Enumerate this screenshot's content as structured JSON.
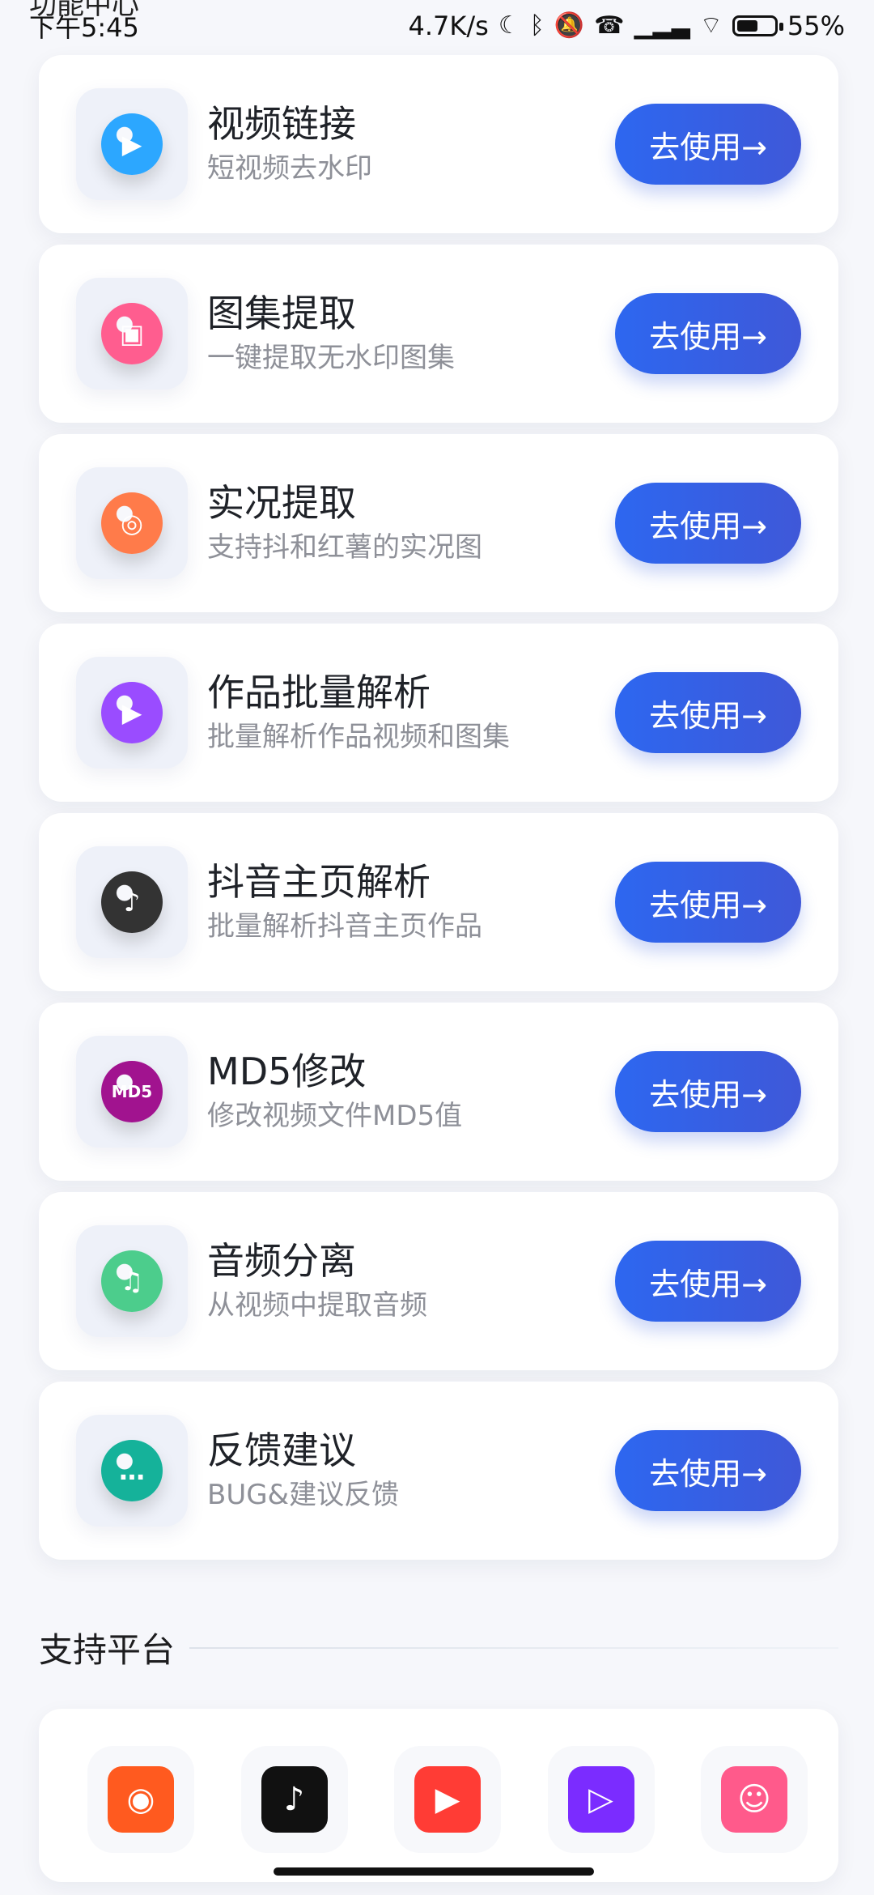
{
  "header": {
    "clipped_title": "功能中心"
  },
  "status_bar": {
    "time": "下午5:45",
    "network_speed": "4.7K/s",
    "battery": "55%"
  },
  "features": [
    {
      "title": "视频链接",
      "subtitle": "短视频去水印",
      "button_label": "去使用→",
      "icon_name": "play-circle-icon",
      "icon_symbol": "▶",
      "color": "#2ca7ff"
    },
    {
      "title": "图集提取",
      "subtitle": "一键提取无水印图集",
      "button_label": "去使用→",
      "icon_name": "image-icon",
      "icon_symbol": "▣",
      "color": "#ff5d8f"
    },
    {
      "title": "实况提取",
      "subtitle": "支持抖和红薯的实况图",
      "button_label": "去使用→",
      "icon_name": "live-photo-icon",
      "icon_symbol": "◎",
      "color": "#ff7b4a"
    },
    {
      "title": "作品批量解析",
      "subtitle": "批量解析作品视频和图集",
      "button_label": "去使用→",
      "icon_name": "film-icon",
      "icon_symbol": "▶",
      "color": "#9a4cff"
    },
    {
      "title": "抖音主页解析",
      "subtitle": "批量解析抖音主页作品",
      "button_label": "去使用→",
      "icon_name": "douyin-icon",
      "icon_symbol": "♪",
      "color": "#333333"
    },
    {
      "title": "MD5修改",
      "subtitle": "修改视频文件MD5值",
      "button_label": "去使用→",
      "icon_name": "md5-file-icon",
      "icon_symbol": "MD5",
      "color": "#a1138f"
    },
    {
      "title": "音频分离",
      "subtitle": "从视频中提取音频",
      "button_label": "去使用→",
      "icon_name": "music-note-icon",
      "icon_symbol": "♫",
      "color": "#4ccd8c"
    },
    {
      "title": "反馈建议",
      "subtitle": "BUG&建议反馈",
      "button_label": "去使用→",
      "icon_name": "chat-bubble-icon",
      "icon_symbol": "…",
      "color": "#15b29a"
    }
  ],
  "section": {
    "title": "支持平台"
  },
  "platforms": [
    {
      "icon_name": "kuaishou-logo-icon",
      "icon_symbol": "◉",
      "color": "#ff5a1f"
    },
    {
      "icon_name": "douyin-logo-icon",
      "icon_symbol": "♪",
      "color": "#111111"
    },
    {
      "icon_name": "xigua-logo-icon",
      "icon_symbol": "▶",
      "color": "#ff3c35"
    },
    {
      "icon_name": "media-logo-icon",
      "icon_symbol": "▷",
      "color": "#7b2cff"
    },
    {
      "icon_name": "pipixia-logo-icon",
      "icon_symbol": "☺",
      "color": "#ff5a8b"
    }
  ]
}
